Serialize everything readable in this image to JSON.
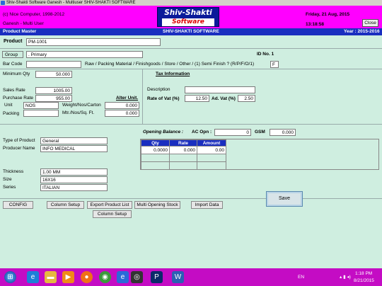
{
  "window": {
    "title": "Shiv-Shakti Software    Ganesh - Multiuser  SHIV-SHAKTI SOFTWARE"
  },
  "header": {
    "copyright": "(c) Nice Computer, 1998-2012",
    "user": "Ganesh - Multi User",
    "logo_line1": "Shiv-Shakti",
    "logo_line2": "Software",
    "date": "Friday, 21 Aug, 2015",
    "time": "13:18:58",
    "close_label": "Close"
  },
  "form_bar": {
    "left": "Product Master",
    "center": "SHIV-SHAKTI SOFTWARE",
    "right": "Year : 2015-2016"
  },
  "product": {
    "label": "Product",
    "value": "PM-1001"
  },
  "group": {
    "label": "Group",
    "value": ". Primary",
    "id_label": "ID No. 1"
  },
  "barcode": {
    "label": "Bar Code",
    "value": "",
    "type_text": "Raw  / Packing Material  / Finishgoods / Store / Other / (1) Semi Finish ? (R/P/F/O/1)",
    "type_value": "F"
  },
  "left": {
    "min_qty_label": "Minimum Qty",
    "min_qty": "50.000",
    "sales_rate_label": "Sales Rate",
    "sales_rate": "1005.00",
    "purchase_rate_label": "Purchase Rate",
    "purchase_rate": "955.00",
    "alter_unit_label": "Alter Unit.",
    "unit_label": "Unit",
    "unit": "NOS",
    "weight_label": "Weight/Nos/Carton",
    "weight": "0.000",
    "packing_label": "Packing",
    "packing": "",
    "mtr_label": "Mtr./Nos/Sq. Ft.",
    "mtr": "0.000"
  },
  "tax": {
    "title": "Tax Information",
    "description_label": "Description",
    "description": "",
    "vat_label": "Rate of Vat (%)",
    "vat": "12.50",
    "advat_label": "Ad. Vat (%)",
    "advat": "2.50"
  },
  "product_info": {
    "type_label": "Type of Product",
    "type": "General",
    "producer_label": "Producer Name",
    "producer": "INFO MEDICAL"
  },
  "opening": {
    "title": "Opening Balance :",
    "ac_label": "AC Opn :",
    "ac_value": "0",
    "gsm_label": "GSM",
    "gsm_value": "0.000",
    "columns": [
      "Qty",
      "Rate",
      "Amount"
    ],
    "row": [
      "0.0000",
      "0.000",
      "0.00"
    ]
  },
  "dimensions": {
    "thickness_label": "Thickness",
    "thickness": "1.00 MM",
    "size_label": "Size",
    "size": "16X16",
    "series_label": "Series",
    "series": "ITALIAN"
  },
  "buttons": {
    "config": "CONFIG",
    "column_setup": "Column Setup",
    "export": "Export Product List",
    "multi_opening": "Multi Opening Stock",
    "import": "Import Data",
    "column_setup2": "Column Setup",
    "save": "Save"
  },
  "taskbar": {
    "lang": "EN",
    "time": "1:18 PM",
    "date": "8/21/2015",
    "icons": [
      "start-icon",
      "ie-icon",
      "folder-icon",
      "media-icon",
      "firefox-icon",
      "chrome-icon",
      "ie2-icon",
      "eye-icon",
      "photoshop-icon",
      "word-icon"
    ]
  }
}
